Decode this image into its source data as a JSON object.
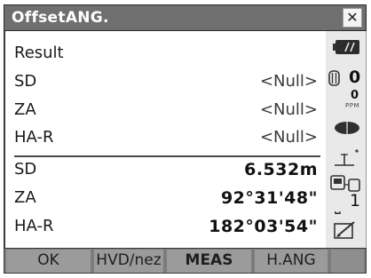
{
  "window": {
    "title": "OffsetANG."
  },
  "result": {
    "heading": "Result",
    "rows": [
      {
        "label": "SD",
        "value": "<Null>"
      },
      {
        "label": "ZA",
        "value": "<Null>"
      },
      {
        "label": "HA-R",
        "value": "<Null>"
      }
    ]
  },
  "measured": {
    "rows": [
      {
        "label": "SD",
        "value": "6.532m"
      },
      {
        "label": "ZA",
        "value": "92°31'48\""
      },
      {
        "label": "HA-R",
        "value": "182°03'54\""
      }
    ]
  },
  "status": {
    "prism_constant": "0",
    "ppm_value": "0",
    "ppm_label": "PPM",
    "face_number": "1"
  },
  "softkeys": [
    {
      "label": "OK"
    },
    {
      "label": "HVD/nez"
    },
    {
      "label": "MEAS"
    },
    {
      "label": "H.ANG"
    },
    {
      "label": ""
    }
  ]
}
